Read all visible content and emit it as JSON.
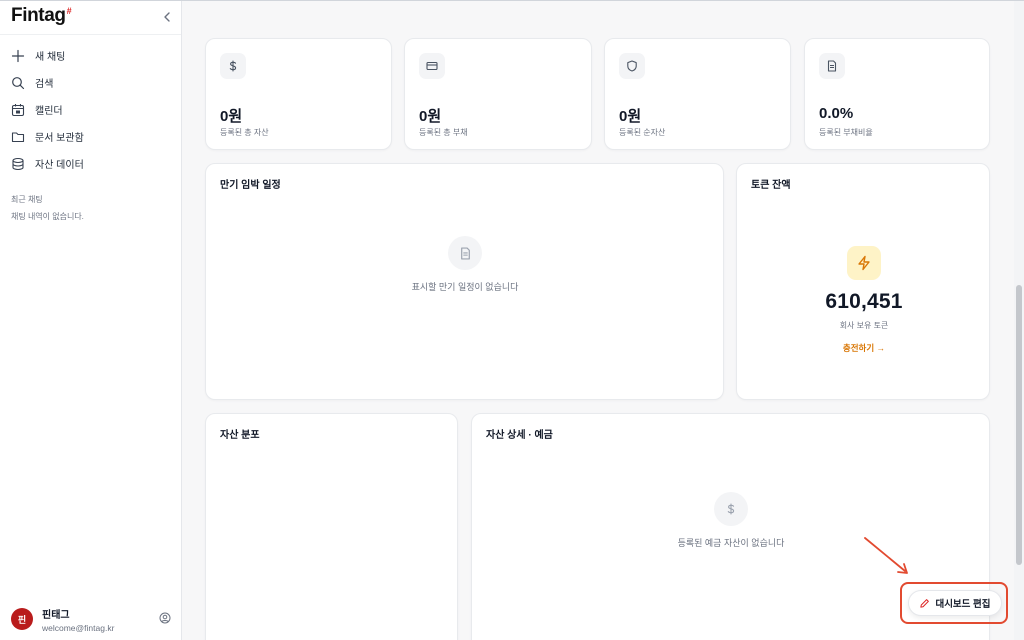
{
  "brand": {
    "name": "Fintag",
    "mark": "#"
  },
  "sidebar": {
    "items": [
      {
        "label": "새 채팅",
        "icon": "plus-icon"
      },
      {
        "label": "검색",
        "icon": "search-icon"
      },
      {
        "label": "캘린더",
        "icon": "calendar-icon"
      },
      {
        "label": "문서 보관함",
        "icon": "folder-icon"
      },
      {
        "label": "자산 데이터",
        "icon": "database-icon"
      }
    ],
    "recent_title": "최근 채팅",
    "recent_empty": "채팅 내역이 없습니다."
  },
  "profile": {
    "avatar_initial": "핀",
    "name": "핀태그",
    "email": "welcome@fintag.kr"
  },
  "stats": [
    {
      "value": "0원",
      "label": "등록된 총 자산",
      "icon": "dollar-icon"
    },
    {
      "value": "0원",
      "label": "등록된 총 부채",
      "icon": "credit-card-icon"
    },
    {
      "value": "0원",
      "label": "등록된 순자산",
      "icon": "shield-icon"
    },
    {
      "value": "0.0%",
      "label": "등록된 부채비율",
      "icon": "document-icon"
    }
  ],
  "maturity": {
    "title": "만기 임박 일정",
    "empty": "표시할 만기 일정이 없습니다"
  },
  "token": {
    "title": "토큰 잔액",
    "value": "610,451",
    "label": "회사 보유 토큰",
    "link": "충전하기 →",
    "accent": "#d97706"
  },
  "distribution": {
    "title": "자산 분포"
  },
  "deposit": {
    "title": "자산 상세 · 예금",
    "empty": "등록된 예금 자산이 없습니다"
  },
  "edit_button": {
    "label": "대시보드 편집"
  },
  "colors": {
    "annotation": "#e24a30",
    "avatar": "#b91c1c"
  }
}
